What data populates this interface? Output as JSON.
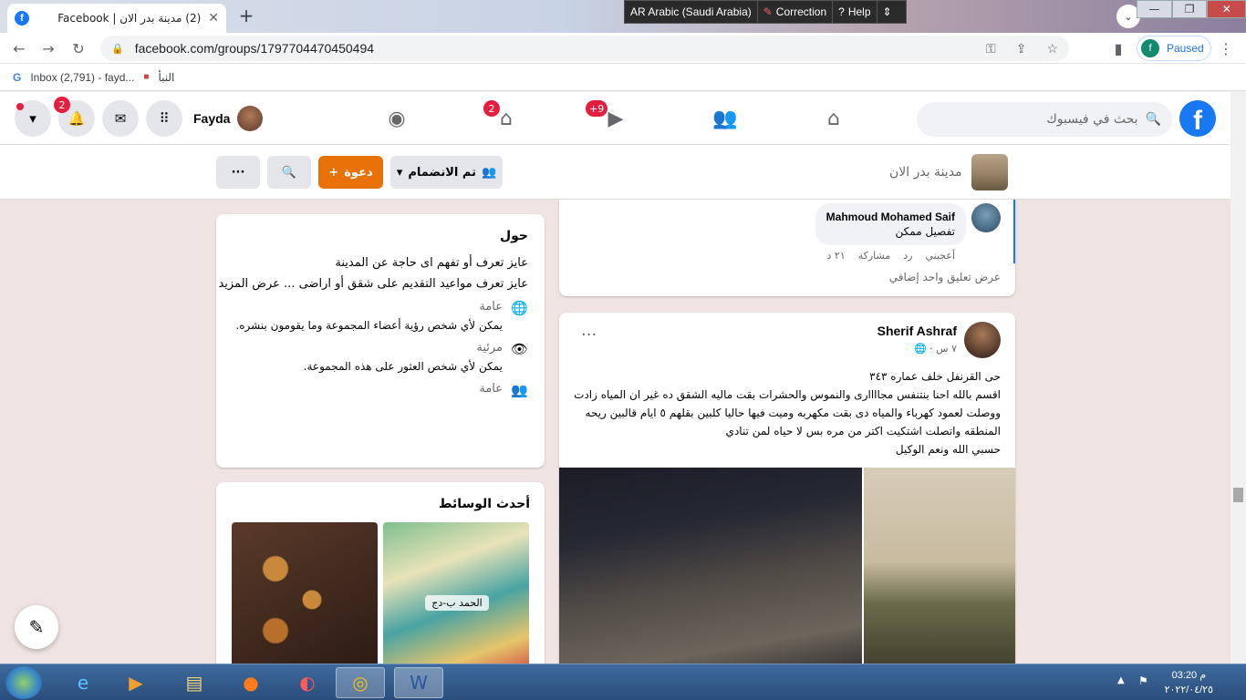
{
  "browser": {
    "tab_title": "(2) مدينة بدر الان | Facebook",
    "url": "facebook.com/groups/1797704470450494",
    "profile_status": "Paused",
    "profile_initial": "f",
    "lang_indicator": "AR Arabic (Saudi Arabia)",
    "correction": "Correction",
    "help": "Help",
    "bookmarks": [
      {
        "label": "Inbox (2,791) - fayd..."
      },
      {
        "label": "النبأ"
      }
    ]
  },
  "fb_header": {
    "search_placeholder": "بحث في فيسبوك",
    "user_name": "Fayda",
    "notifications_badge": "2",
    "marketplace_badge": "2",
    "watch_badge": "+9"
  },
  "group_bar": {
    "group_name": "مدينة بدر الان",
    "joined_label": "تم الانضمام",
    "invite_label": "دعوة"
  },
  "about": {
    "title": "حول",
    "line1": "عايز تعرف أو تفهم اى حاجة عن المدينة",
    "line2": "عايز تعرف مواعيد التقديم على شقق أو اراضى ... عرض المزيد",
    "public_title": "عامة",
    "public_desc": "يمكن لأي شخص رؤية أعضاء المجموعة وما يقومون بنشره.",
    "visible_title": "مرئية",
    "visible_desc": "يمكن لأي شخص العثور على هذه المجموعة.",
    "general_title": "عامة"
  },
  "media": {
    "title": "أحدث الوسائط",
    "image1_text": "الحمد ب-دج"
  },
  "comment": {
    "author": "Mahmoud Mohamed Saif",
    "text": "تفصيل ممكن",
    "like": "أعجبني",
    "reply": "رد",
    "share": "مشاركة",
    "time": "٢١ د",
    "more_comments": "عرض تعليق واحد إضافي"
  },
  "post": {
    "author": "Sherif Ashraf",
    "time": "٧ س ·",
    "lines": [
      "حى القرنفل  خلف عماره ٣٤٣",
      "اقسم بالله احنا بنتنفس مجاااارى  والنموس والحشرات بقت ماليه الشقق ده غير ان المياه زادت",
      "ووصلت لعمود كهرباء والمياه دى بقت مكهربه وميت فيها حاليا كلبين بقلهم ٥ ايام قالبين ريحه",
      "المنطقه واتصلت اشتكيت اكتر من مره بس لا حياه لمن تنادي",
      "حسبي الله ونعم الوكيل"
    ]
  },
  "taskbar": {
    "time": "03:20 م",
    "date": "٢٠٢٢/٠٤/٢٥"
  }
}
